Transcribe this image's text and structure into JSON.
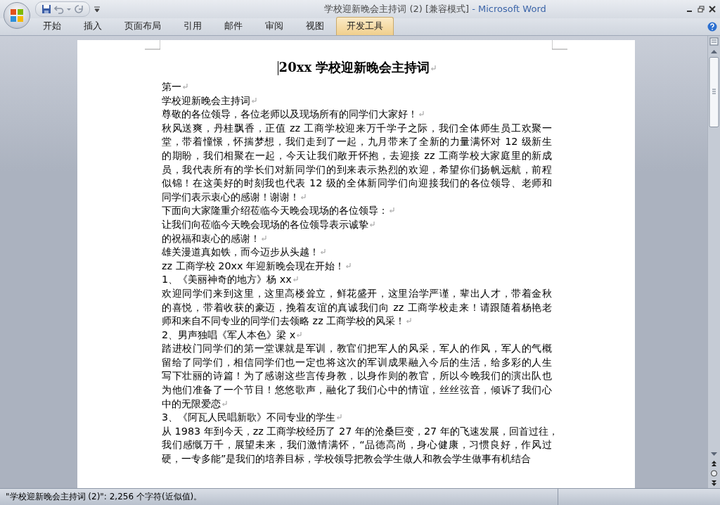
{
  "title_bar": {
    "document": "学校迎新晚会主持词 (2) [兼容模式]",
    "app": "- Microsoft Word"
  },
  "ribbon_tabs": [
    {
      "label": "开始",
      "selected": false
    },
    {
      "label": "插入",
      "selected": false
    },
    {
      "label": "页面布局",
      "selected": false
    },
    {
      "label": "引用",
      "selected": false
    },
    {
      "label": "邮件",
      "selected": false
    },
    {
      "label": "审阅",
      "selected": false
    },
    {
      "label": "视图",
      "selected": false
    },
    {
      "label": "开发工具",
      "selected": true
    }
  ],
  "document": {
    "title": "20xx 学校迎新晚会主持词",
    "paragraphs": [
      {
        "text": "第一",
        "mark": true
      },
      {
        "text": "学校迎新晚会主持词",
        "mark": true
      },
      {
        "text": "尊敬的各位领导，各位老师以及现场所有的同学们大家好！",
        "mark": true
      },
      {
        "lines": [
          "秋风送爽，丹桂飘香，正值 zz 工商学校迎来万千学子之际，我们全体师生员工欢聚一",
          "堂，带着憧憬，怀揣梦想，我们走到了一起，九月带来了全新的力量满怀对 12 级新生",
          "的期盼，我们相聚在一起，今天让我们敞开怀抱，去迎接 zz 工商学校大家庭里的新成",
          "员，我代表所有的学长们对新同学们的到来表示热烈的欢迎，希望你们扬帆远航，前程",
          "似锦！在这美好的时刻我也代表 12 级的全体新同学们向迎接我们的各位领导、老师和",
          "同学们表示衷心的感谢！谢谢！"
        ],
        "mark": true
      },
      {
        "text": "下面向大家隆重介绍莅临今天晚会现场的各位领导：",
        "mark": true
      },
      {
        "text": "让我们向莅临今天晚会现场的各位领导表示诚挚",
        "mark": true
      },
      {
        "text": "的祝福和衷心的感谢！",
        "mark": true
      },
      {
        "text": "雄关漫道真如铁，而今迈步从头越！",
        "mark": true
      },
      {
        "text": "zz 工商学校 20xx 年迎新晚会现在开始！",
        "mark": true
      },
      {
        "text": "1、《美丽神奇的地方》杨 xx",
        "mark": true
      },
      {
        "lines": [
          "欢迎同学们来到这里，这里高楼耸立，鲜花盛开，这里治学严谨，辈出人才，带着金秋",
          "的喜悦，带着收获的豪迈，挽着友谊的真诚我们向 zz 工商学校走来！请跟随着杨艳老",
          "师和来自不同专业的同学们去领略 zz 工商学校的风采！"
        ],
        "mark": true
      },
      {
        "text": "2、男声独唱《军人本色》梁 x",
        "mark": true
      },
      {
        "lines": [
          "踏进校门同学们的第一堂课就是军训，教官们把军人的风采，军人的作风，军人的气概",
          "留给了同学们，相信同学们也一定也将这次的军训成果融入今后的生活，给多彩的人生",
          "写下壮丽的诗篇！为了感谢这些言传身教，以身作则的教官，所以今晚我们的演出队也",
          "为他们准备了一个节目！悠悠歌声，融化了我们心中的情谊，丝丝弦音，倾诉了我们心",
          "中的无限爱恋"
        ],
        "mark": true
      },
      {
        "text": "3、《阿瓦人民唱新歌》不同专业的学生",
        "mark": true
      },
      {
        "lines": [
          "从 1983 年到今天，zz 工商学校经历了 27 年的沧桑巨变，27 年的飞速发展，回首过往，",
          "我们感慨万千，展望未来，我们激情满怀，“品德高尚，身心健康，习惯良好，作风过",
          "硬，一专多能”是我们的培养目标，学校领导把教会学生做人和教会学生做事有机结合"
        ],
        "mark": false
      }
    ]
  },
  "status_bar": {
    "text": "\"学校迎新晚会主持词 (2)\": 2,256 个字符(近似值)。"
  }
}
